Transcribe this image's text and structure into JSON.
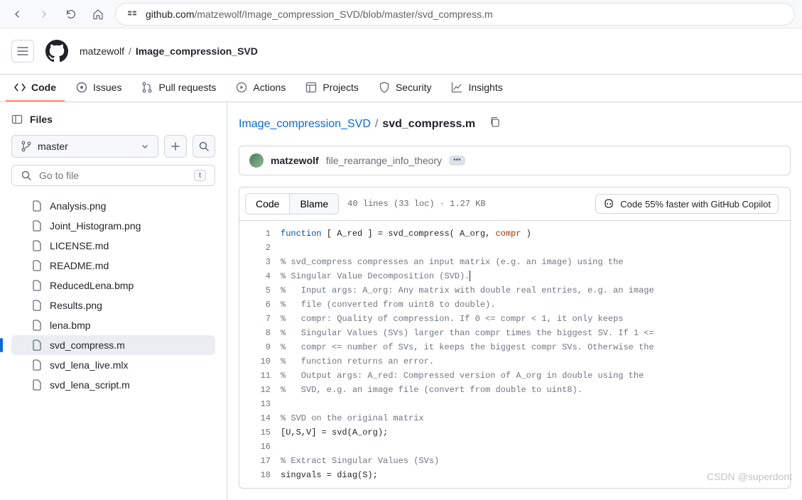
{
  "browser": {
    "host": "github.com",
    "path": "/matzewolf/Image_compression_SVD/blob/master/svd_compress.m"
  },
  "repo": {
    "owner": "matzewolf",
    "name": "Image_compression_SVD"
  },
  "nav": {
    "code": "Code",
    "issues": "Issues",
    "pull_requests": "Pull requests",
    "actions": "Actions",
    "projects": "Projects",
    "security": "Security",
    "insights": "Insights"
  },
  "sidebar": {
    "title": "Files",
    "branch": "master",
    "filter_placeholder": "Go to file",
    "filter_kbd": "t",
    "files": [
      "Analysis.png",
      "Joint_Histogram.png",
      "LICENSE.md",
      "README.md",
      "ReducedLena.bmp",
      "Results.png",
      "lena.bmp",
      "svd_compress.m",
      "svd_lena_live.mlx",
      "svd_lena_script.m"
    ],
    "active_file": "svd_compress.m"
  },
  "breadcrumb": {
    "root": "Image_compression_SVD",
    "current": "svd_compress.m"
  },
  "commit": {
    "author": "matzewolf",
    "message": "file_rearrange_info_theory"
  },
  "toolbar": {
    "code": "Code",
    "blame": "Blame",
    "info": "40 lines (33 loc) · 1.27 KB",
    "copilot": "Code 55% faster with GitHub Copilot"
  },
  "code": {
    "lines": [
      {
        "n": 1,
        "tokens": [
          {
            "t": "function",
            "c": "kw"
          },
          {
            "t": " [ A_red ] = svd_compress( A_org, ",
            "c": ""
          },
          {
            "t": "compr",
            "c": "arg"
          },
          {
            "t": " )",
            "c": ""
          }
        ]
      },
      {
        "n": 2,
        "tokens": []
      },
      {
        "n": 3,
        "tokens": [
          {
            "t": "% svd_compress compresses an input matrix (e.g. an image) using the",
            "c": "com"
          }
        ]
      },
      {
        "n": 4,
        "tokens": [
          {
            "t": "% Singular Value Decomposition (SVD).",
            "c": "com"
          }
        ],
        "cursor": true
      },
      {
        "n": 5,
        "tokens": [
          {
            "t": "%   Input args: A_org: Any matrix with double real entries, e.g. an image",
            "c": "com"
          }
        ]
      },
      {
        "n": 6,
        "tokens": [
          {
            "t": "%   file (converted from uint8 to double).",
            "c": "com"
          }
        ]
      },
      {
        "n": 7,
        "tokens": [
          {
            "t": "%   compr: Quality of compression. If 0 <= compr < 1, it only keeps",
            "c": "com"
          }
        ]
      },
      {
        "n": 8,
        "tokens": [
          {
            "t": "%   Singular Values (SVs) larger than compr times the biggest SV. If 1 <=",
            "c": "com"
          }
        ]
      },
      {
        "n": 9,
        "tokens": [
          {
            "t": "%   compr <= number of SVs, it keeps the biggest compr SVs. Otherwise the",
            "c": "com"
          }
        ]
      },
      {
        "n": 10,
        "tokens": [
          {
            "t": "%   function returns an error.",
            "c": "com"
          }
        ]
      },
      {
        "n": 11,
        "tokens": [
          {
            "t": "%   Output args: A_red: Compressed version of A_org in double using the",
            "c": "com"
          }
        ]
      },
      {
        "n": 12,
        "tokens": [
          {
            "t": "%   SVD, e.g. an image file (convert from double to uint8).",
            "c": "com"
          }
        ]
      },
      {
        "n": 13,
        "tokens": []
      },
      {
        "n": 14,
        "tokens": [
          {
            "t": "% SVD on the original matrix",
            "c": "com"
          }
        ]
      },
      {
        "n": 15,
        "tokens": [
          {
            "t": "[U,S,V] = svd(A_org);",
            "c": ""
          }
        ]
      },
      {
        "n": 16,
        "tokens": []
      },
      {
        "n": 17,
        "tokens": [
          {
            "t": "% Extract Singular Values (SVs)",
            "c": "com"
          }
        ]
      },
      {
        "n": 18,
        "tokens": [
          {
            "t": "singvals = diag(S);",
            "c": ""
          }
        ]
      }
    ]
  },
  "watermark": "CSDN @superdont"
}
